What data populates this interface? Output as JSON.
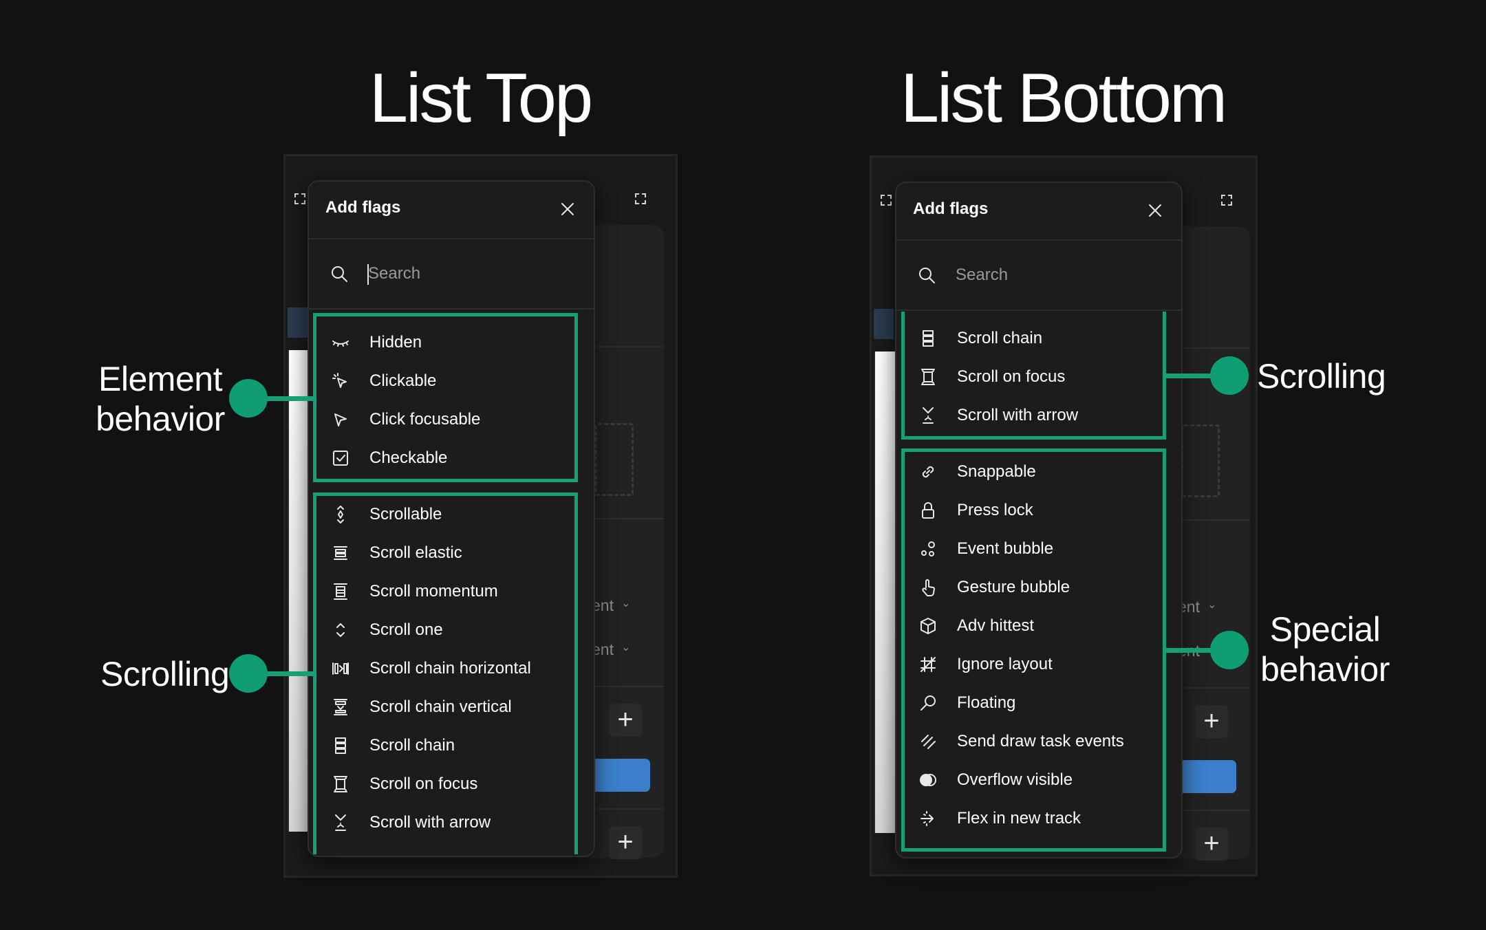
{
  "left": {
    "title": "List Top",
    "modal_title": "Add flags",
    "search_placeholder": "Search",
    "items": [
      {
        "label": "Hidden",
        "icon": "eye-closed-icon"
      },
      {
        "label": "Clickable",
        "icon": "cursor-click-icon"
      },
      {
        "label": "Click focusable",
        "icon": "cursor-icon"
      },
      {
        "label": "Checkable",
        "icon": "checkbox-icon"
      },
      {
        "label": "Scrollable",
        "icon": "scroll-updown-icon"
      },
      {
        "label": "Scroll elastic",
        "icon": "scroll-elastic-icon"
      },
      {
        "label": "Scroll momentum",
        "icon": "scroll-momentum-icon"
      },
      {
        "label": "Scroll one",
        "icon": "chevrons-updown-icon"
      },
      {
        "label": "Scroll chain horizontal",
        "icon": "scroll-chain-horizontal-icon"
      },
      {
        "label": "Scroll chain vertical",
        "icon": "scroll-chain-vertical-icon"
      },
      {
        "label": "Scroll chain",
        "icon": "scroll-chain-icon"
      },
      {
        "label": "Scroll on focus",
        "icon": "scroll-focus-icon"
      },
      {
        "label": "Scroll with arrow",
        "icon": "scroll-arrow-icon"
      }
    ],
    "annotations": [
      "Element behavior",
      "Scrolling"
    ],
    "bg_dropdowns": [
      "ent",
      "ent"
    ]
  },
  "right": {
    "title": "List Bottom",
    "modal_title": "Add flags",
    "search_placeholder": "Search",
    "items": [
      {
        "label": "Scroll chain",
        "icon": "scroll-chain-icon"
      },
      {
        "label": "Scroll on focus",
        "icon": "scroll-focus-icon"
      },
      {
        "label": "Scroll with arrow",
        "icon": "scroll-arrow-icon"
      },
      {
        "label": "Snappable",
        "icon": "link-icon"
      },
      {
        "label": "Press lock",
        "icon": "lock-icon"
      },
      {
        "label": "Event bubble",
        "icon": "bubbles-icon"
      },
      {
        "label": "Gesture bubble",
        "icon": "hand-pointer-icon"
      },
      {
        "label": "Adv hittest",
        "icon": "cube-icon"
      },
      {
        "label": "Ignore layout",
        "icon": "grid-slash-icon"
      },
      {
        "label": "Floating",
        "icon": "magnifier-icon"
      },
      {
        "label": "Send draw task events",
        "icon": "brush-icon"
      },
      {
        "label": "Overflow visible",
        "icon": "overflow-icon"
      },
      {
        "label": "Flex in new track",
        "icon": "arrow-track-icon"
      }
    ],
    "annotations": [
      "Scrolling",
      "Special behavior"
    ],
    "bg_dropdowns": [
      "ent",
      "ent"
    ]
  },
  "colors": {
    "background": "#121212",
    "accent_green": "#17a078",
    "modal_bg": "#1c1c1c",
    "blue_button": "#3a7fcb"
  }
}
